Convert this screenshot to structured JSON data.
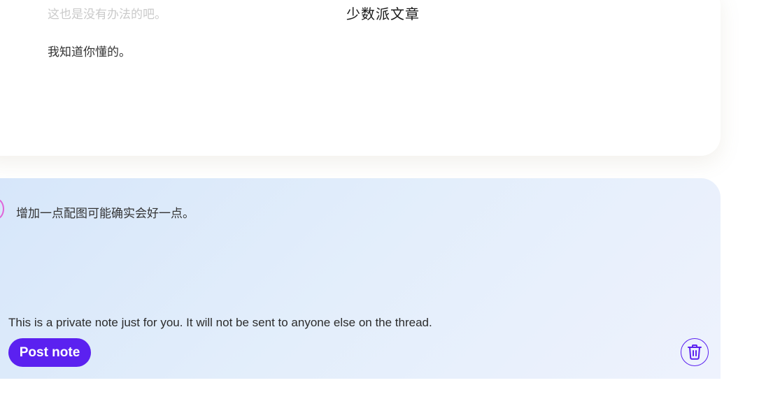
{
  "header": {
    "title": "少数派文章",
    "faded_text": "这也是没有办法的吧。"
  },
  "email": {
    "body_line": "我知道你懂的。"
  },
  "note": {
    "text": "增加一点配图可能确实会好一点。",
    "private_message": "This is a private note just for you. It will not be sent to anyone else on the thread.",
    "post_label": "Post note",
    "delete_icon": "trash-icon"
  },
  "colors": {
    "accent": "#5b21f0",
    "note_bg_start": "#d6e6fa",
    "note_bg_end": "#eef2fd",
    "pink_marker": "#e064d8"
  }
}
